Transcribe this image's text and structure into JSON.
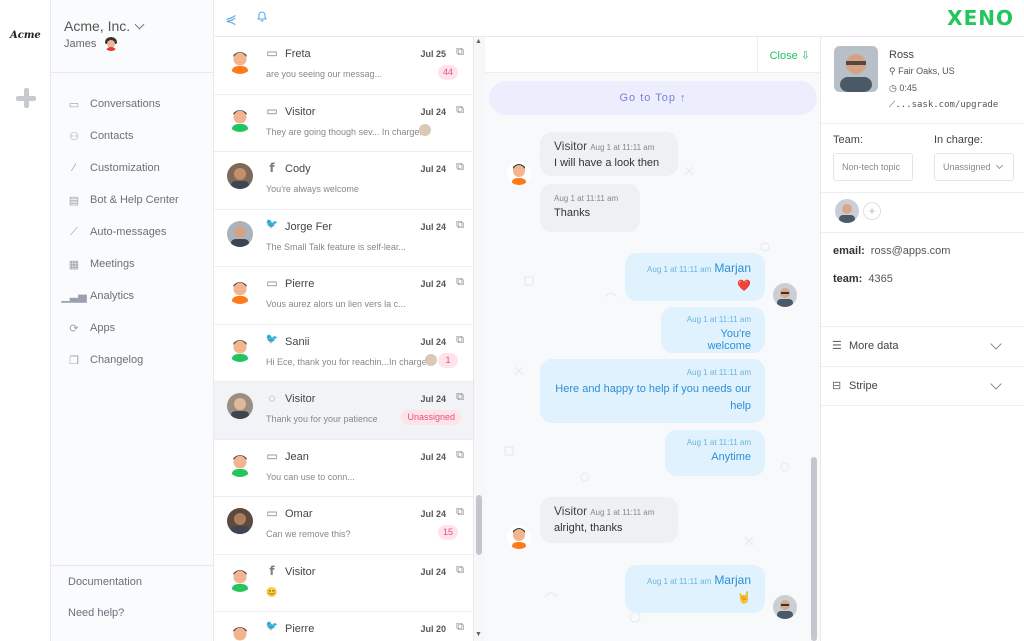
{
  "app": {
    "logo_text": "Acme",
    "brand": "XENO"
  },
  "sidebar": {
    "org_name": "Acme, Inc.",
    "user_name": "James",
    "items": [
      {
        "label": "Conversations",
        "icon": "chat-bubble-icon"
      },
      {
        "label": "Contacts",
        "icon": "person-icon"
      },
      {
        "label": "Customization",
        "icon": "wand-icon"
      },
      {
        "label": "Bot & Help Center",
        "icon": "book-icon"
      },
      {
        "label": "Auto-messages",
        "icon": "trend-icon"
      },
      {
        "label": "Meetings",
        "icon": "calendar-icon"
      },
      {
        "label": "Analytics",
        "icon": "bar-chart-icon"
      },
      {
        "label": "Apps",
        "icon": "refresh-icon"
      },
      {
        "label": "Changelog",
        "icon": "pages-icon"
      }
    ],
    "documentation": "Documentation",
    "help": "Need help?"
  },
  "conversations": [
    {
      "name": "Freta",
      "channel": "chat",
      "date": "Jul 25",
      "preview": "are you seeing our messag...",
      "badge": "44",
      "avatar": "orange"
    },
    {
      "name": "Visitor",
      "channel": "chat",
      "date": "Jul 24",
      "preview": "They are going though sev... In charge:",
      "badge": "",
      "avatar": "green",
      "charge": true
    },
    {
      "name": "Cody",
      "channel": "facebook",
      "date": "Jul 24",
      "preview": "You're always welcome",
      "badge": "",
      "avatar": "photo"
    },
    {
      "name": "Jorge Fer",
      "channel": "twitter",
      "date": "Jul 24",
      "preview": "The Small Talk feature is self-lear...",
      "badge": "",
      "avatar": "photo2"
    },
    {
      "name": "Pierre",
      "channel": "chat",
      "date": "Jul 24",
      "preview": "Vous aurez alors un lien vers la c...",
      "badge": "",
      "avatar": "orange"
    },
    {
      "name": "Sanii",
      "channel": "twitter",
      "date": "Jul 24",
      "preview": "Hi Ece, thank you for reachin...In charge:",
      "badge": "1",
      "avatar": "green",
      "charge": true
    },
    {
      "name": "Visitor",
      "channel": "whatsapp",
      "date": "Jul 24",
      "preview": "Thank you for your patience",
      "badge": "Unassigned",
      "avatar": "photo3",
      "active": true
    },
    {
      "name": "Jean",
      "channel": "chat",
      "date": "Jul 24",
      "preview": "You can use to conn...",
      "badge": "",
      "avatar": "green"
    },
    {
      "name": "Omar",
      "channel": "chat",
      "date": "Jul 24",
      "preview": "Can we remove this?",
      "badge": "15",
      "avatar": "photo4"
    },
    {
      "name": "Visitor",
      "channel": "facebook",
      "date": "Jul 24",
      "preview": "😊",
      "badge": "",
      "avatar": "green"
    },
    {
      "name": "Pierre",
      "channel": "twitter",
      "date": "Jul 20",
      "preview": "",
      "badge": "",
      "avatar": "orange"
    }
  ],
  "chat": {
    "close_label": "Close",
    "goto_label": "Go to Top ↑",
    "messages": [
      {
        "dir": "in",
        "sender": "Visitor",
        "time": "Aug 1 at 11:11 am",
        "text": "I will have a look then"
      },
      {
        "dir": "in",
        "sender": "",
        "time": "Aug 1 at 11:11 am",
        "text": "Thanks"
      },
      {
        "dir": "out",
        "sender": "Marjan",
        "time": "Aug 1 at 11:11 am",
        "text": "❤️"
      },
      {
        "dir": "out",
        "sender": "",
        "time": "Aug 1 at 11:11 am",
        "text": "You're welcome"
      },
      {
        "dir": "out",
        "sender": "",
        "time": "Aug 1 at 11:11 am",
        "text": "Here and happy to help if you needs our help"
      },
      {
        "dir": "out",
        "sender": "",
        "time": "Aug 1 at 11:11 am",
        "text": "Anytime"
      },
      {
        "dir": "in",
        "sender": "Visitor",
        "time": "Aug 1 at 11:11 am",
        "text": "alright, thanks"
      },
      {
        "dir": "out",
        "sender": "Marjan",
        "time": "Aug 1 at 11:11 am",
        "text": "🤘"
      }
    ]
  },
  "profile": {
    "name": "Ross",
    "location": "Fair Oaks, US",
    "time": "0:45",
    "url": "...sask.com/upgrade",
    "team_label": "Team:",
    "team_value": "Non-tech topic",
    "charge_label": "In charge:",
    "charge_value": "Unassigned",
    "email_key": "email:",
    "email_value": "ross@apps.com",
    "team_key": "team:",
    "team_num": "4365",
    "more_data": "More data",
    "stripe": "Stripe"
  }
}
